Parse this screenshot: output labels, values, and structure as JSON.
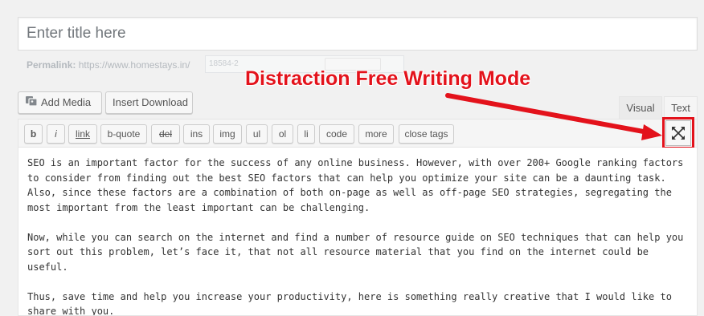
{
  "title_placeholder": "Enter title here",
  "permalink": {
    "label": "Permalink:",
    "url": "https://www.homestays.in/",
    "slug": "18584-2"
  },
  "media_buttons": {
    "add_media": "Add Media",
    "insert_download": "Insert Download"
  },
  "callout_text": "Distraction Free Writing Mode",
  "editor_tabs": {
    "visual": "Visual",
    "text": "Text",
    "active": "text"
  },
  "quicktags": [
    "b",
    "i",
    "link",
    "b-quote",
    "del",
    "ins",
    "img",
    "ul",
    "ol",
    "li",
    "code",
    "more",
    "close tags"
  ],
  "dfw_icon": "fullscreen-expand-icon",
  "content_paragraphs": [
    "SEO is an important factor for the success of any online business. However, with over 200+ Google ranking factors to consider from finding out the best SEO factors that can help you optimize your site can be a daunting task. Also, since these factors are a combination of both on-page as well as off-page SEO strategies, segregating the most important from the least important can be challenging.",
    "Now, while you can search on the internet and find a number of resource guide on SEO techniques that can help you sort out this problem, let’s face it, that not all resource material that you find on the internet could be useful.",
    "Thus, save time and help you increase your productivity, here is something really creative that I would like to share with you."
  ],
  "colors": {
    "annotation_red": "#e3121b",
    "background": "#f1f1f1",
    "editor_bg": "#ffffff"
  }
}
